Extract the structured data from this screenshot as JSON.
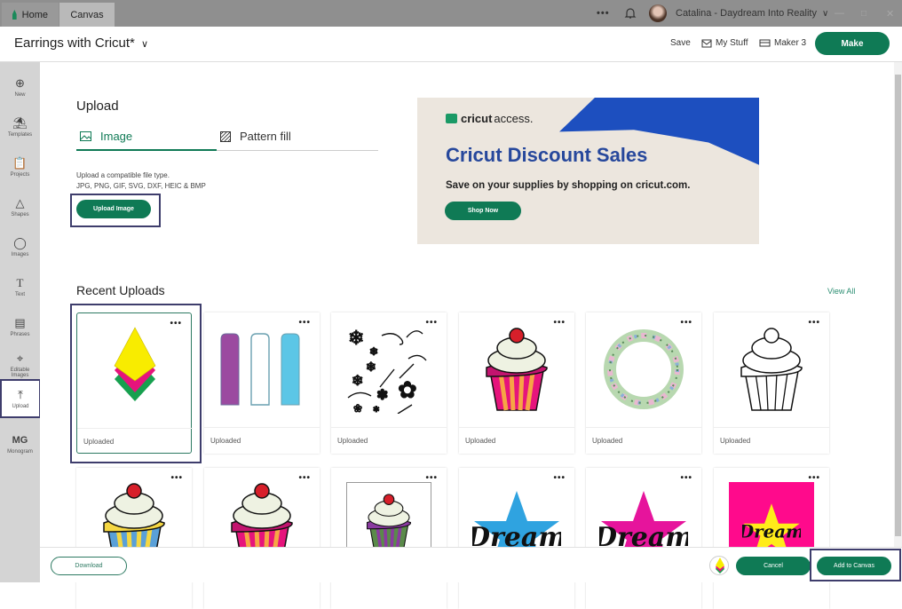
{
  "titlebar": {
    "tabs": [
      {
        "label": "Home",
        "icon": "home-icon"
      },
      {
        "label": "Canvas"
      }
    ],
    "more_label": "•••",
    "user": "Catalina - Daydream Into Reality"
  },
  "header": {
    "project_title": "Earrings with Cricut*",
    "save_label": "Save",
    "my_stuff_label": "My Stuff",
    "machine_label": "Maker 3",
    "make_label": "Make"
  },
  "sidebar": {
    "items": [
      {
        "label": "New",
        "icon": "plus-circle-icon"
      },
      {
        "label": "Templates",
        "icon": "shirt-icon"
      },
      {
        "label": "Projects",
        "icon": "clipboard-icon"
      },
      {
        "label": "Shapes",
        "icon": "shapes-icon"
      },
      {
        "label": "Images",
        "icon": "lightbulb-icon"
      },
      {
        "label": "Text",
        "icon": "text-icon"
      },
      {
        "label": "Phrases",
        "icon": "speech-bubble-icon"
      },
      {
        "label": "Editable Images",
        "icon": "editable-image-icon"
      },
      {
        "label": "Upload",
        "icon": "upload-icon",
        "active": true
      },
      {
        "label": "Monogram",
        "icon": "monogram-icon"
      }
    ]
  },
  "upload": {
    "title": "Upload",
    "tabs": [
      {
        "label": "Image",
        "active": true
      },
      {
        "label": "Pattern fill"
      }
    ],
    "help_line1": "Upload a compatible file type.",
    "help_line2": "JPG, PNG, GIF, SVG, DXF, HEIC & BMP",
    "button_label": "Upload Image"
  },
  "banner": {
    "brand_bold": "cricut",
    "brand_light": "access.",
    "headline": "Cricut Discount Sales",
    "subtext": "Save on your supplies by shopping on cricut.com.",
    "button_label": "Shop Now"
  },
  "recent": {
    "title": "Recent Uploads",
    "view_all": "View All",
    "items": [
      {
        "label": "Uploaded",
        "image": "layered-diamond-earrings",
        "selected": true
      },
      {
        "label": "Uploaded",
        "image": "bookmark-tags"
      },
      {
        "label": "Uploaded",
        "image": "snowflakes-and-flourishes"
      },
      {
        "label": "Uploaded",
        "image": "pink-orange-cupcake"
      },
      {
        "label": "Uploaded",
        "image": "floral-wreath"
      },
      {
        "label": "Uploaded",
        "image": "outline-cupcake"
      },
      {
        "label": "",
        "image": "yellow-blue-cupcake"
      },
      {
        "label": "",
        "image": "pink-orange-cupcake-2"
      },
      {
        "label": "",
        "image": "purple-green-cupcake"
      },
      {
        "label": "",
        "image": "dream-blue-star"
      },
      {
        "label": "",
        "image": "dream-pink-star"
      },
      {
        "label": "",
        "image": "dream-yellow-star-pink-bg"
      }
    ]
  },
  "footer": {
    "download_label": "Download",
    "cancel_label": "Cancel",
    "add_label": "Add to Canvas"
  },
  "colors": {
    "accent": "#0f7a55",
    "highlight_border": "#3e3d6c",
    "banner_blue": "#1d4fbf",
    "banner_headline": "#27489c"
  }
}
